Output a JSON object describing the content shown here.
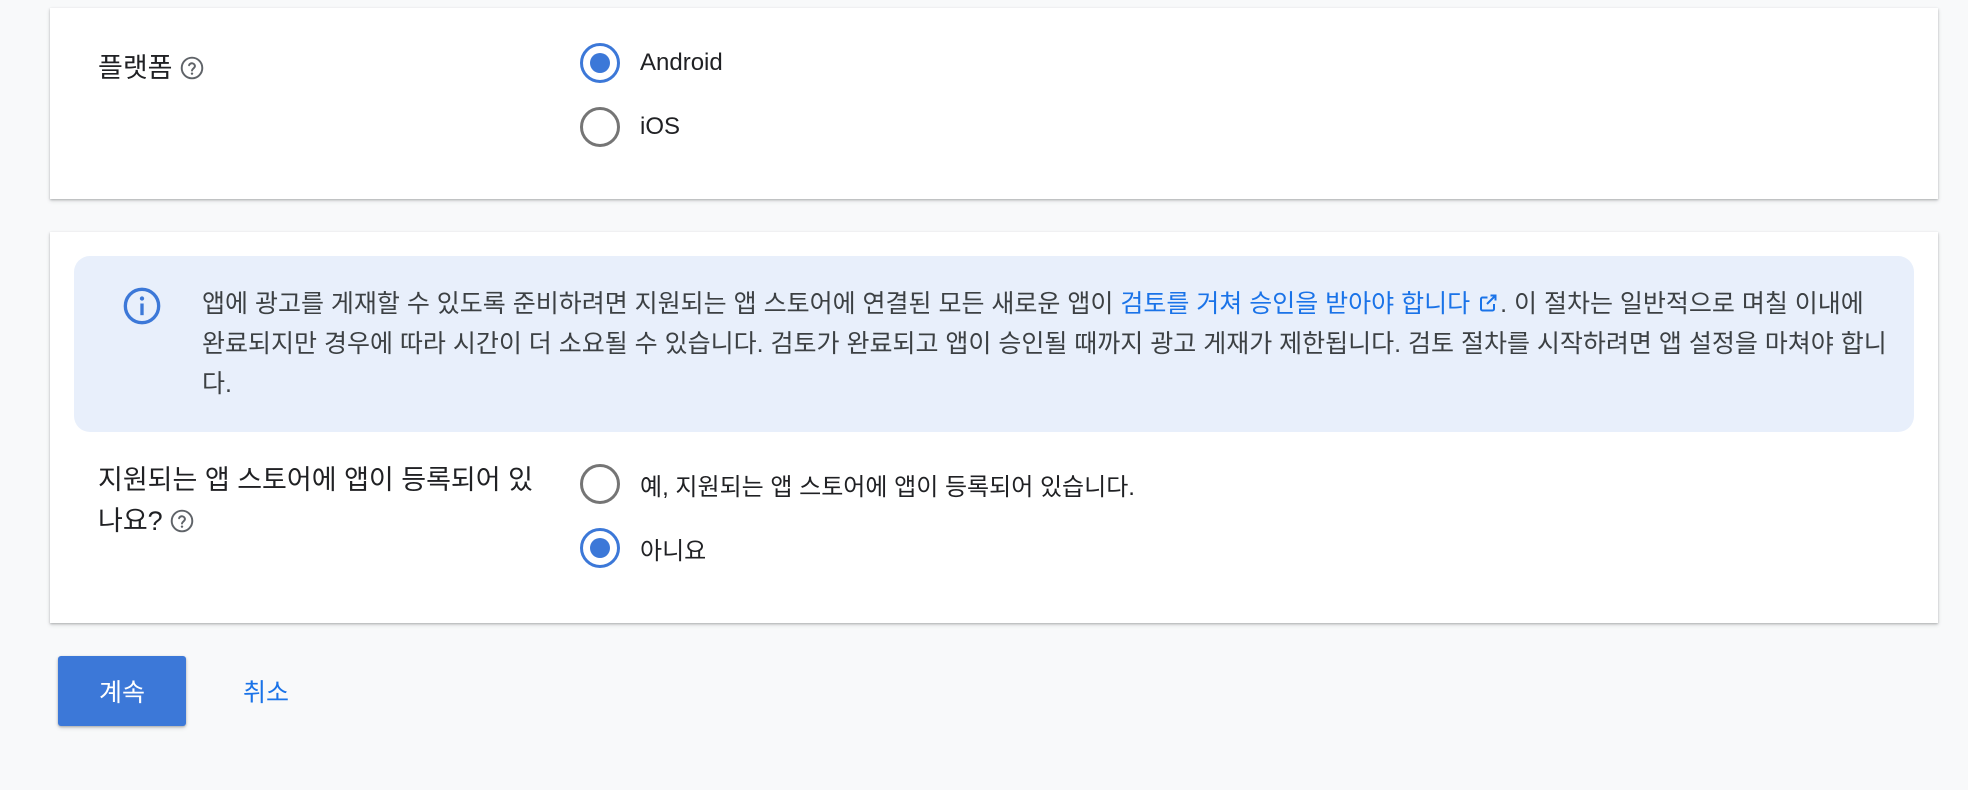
{
  "platform": {
    "label": "플랫폼",
    "help_icon": "help-circle-icon",
    "options": [
      {
        "label": "Android",
        "checked": true
      },
      {
        "label": "iOS",
        "checked": false
      }
    ]
  },
  "info": {
    "icon": "info-icon",
    "text_before": "앱에 광고를 게재할 수 있도록 준비하려면 지원되는 앱 스토어에 연결된 모든 새로운 앱이 ",
    "link_text": "검토를 거쳐 승인을 받아야 합니다",
    "link_icon": "open-in-new-icon",
    "text_after": ". 이 절차는 일반적으로 며칠 이내에 완료되지만 경우에 따라 시간이 더 소요될 수 있습니다. 검토가 완료되고 앱이 승인될 때까지 광고 게재가 제한됩니다. 검토 절차를 시작하려면 앱 설정을 마쳐야 합니다."
  },
  "store": {
    "label": "지원되는 앱 스토어에 앱이 등록되어 있나요?",
    "help_icon": "help-circle-icon",
    "options": [
      {
        "label": "예, 지원되는 앱 스토어에 앱이 등록되어 있습니다.",
        "checked": false
      },
      {
        "label": "아니요",
        "checked": true
      }
    ]
  },
  "buttons": {
    "continue_label": "계속",
    "cancel_label": "취소"
  },
  "colors": {
    "accent": "#3c78d8",
    "link": "#1a73e8",
    "info_background": "#e8effb",
    "page_background": "#f8f9fa"
  }
}
